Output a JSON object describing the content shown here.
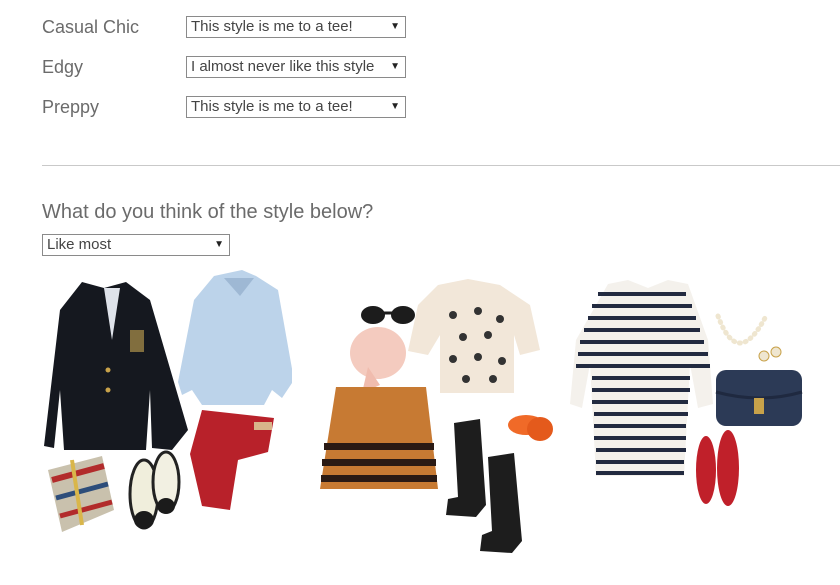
{
  "ratings": [
    {
      "label": "Casual Chic",
      "value": "This style is me to a tee!"
    },
    {
      "label": "Edgy",
      "value": "I almost never like this style"
    },
    {
      "label": "Preppy",
      "value": "This style is me to a tee!"
    }
  ],
  "question": {
    "text": "What do you think of the style below?",
    "selected": "Like most"
  },
  "icons": {
    "dropdown": "triangle-down-icon"
  },
  "colors": {
    "divider": "#c9c9c9",
    "text": "#6b6b6b"
  }
}
